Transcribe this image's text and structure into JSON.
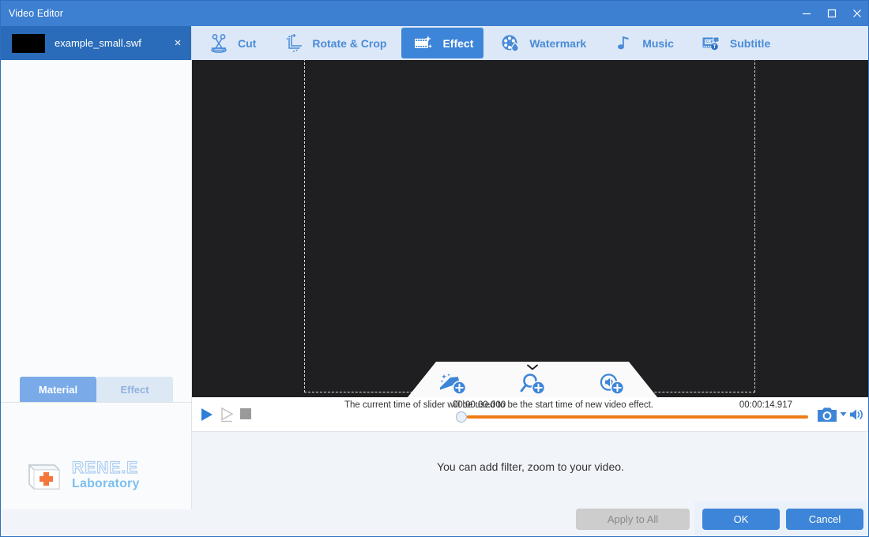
{
  "window": {
    "title": "Video Editor",
    "controls": [
      {
        "name": "minimize",
        "glyph": "minimize-icon"
      },
      {
        "name": "maximize",
        "glyph": "maximize-icon"
      },
      {
        "name": "close",
        "glyph": "close-icon"
      }
    ]
  },
  "sidebar": {
    "file": {
      "name": "example_small.swf",
      "close_label": "×",
      "thumbnail": "black-thumbnail"
    },
    "tabs": [
      {
        "label": "Material",
        "active": true
      },
      {
        "label": "Effect",
        "active": false
      }
    ],
    "logo": {
      "main": "RENE.E",
      "sub": "Laboratory",
      "icon": "rene-key-logo-icon"
    }
  },
  "toolbar": {
    "tabs": [
      {
        "label": "Cut",
        "icon": "scissors-icon",
        "active": false
      },
      {
        "label": "Rotate & Crop",
        "icon": "rotate-crop-icon",
        "active": false
      },
      {
        "label": "Effect",
        "icon": "film-sparkle-icon",
        "active": true
      },
      {
        "label": "Watermark",
        "icon": "watermark-droplet-icon",
        "active": false
      },
      {
        "label": "Music",
        "icon": "music-note-icon",
        "active": false
      },
      {
        "label": "Subtitle",
        "icon": "subtitle-icon",
        "active": false
      }
    ]
  },
  "preview": {
    "selection_visible": true,
    "effect_popup": {
      "chevron": "chevron-down-icon",
      "actions": [
        {
          "name": "add-filter",
          "icon": "magic-wand-plus-icon"
        },
        {
          "name": "add-zoom",
          "icon": "magnifier-plus-icon"
        },
        {
          "name": "add-volume",
          "icon": "speaker-plus-icon"
        }
      ]
    }
  },
  "transport": {
    "play": "play-icon",
    "step": "step-forward-icon",
    "stop": "stop-icon",
    "start_time": "00:00:00.000",
    "end_time": "00:00:14.917",
    "hint": "The current time of slider will be used to be the start time of new video effect.",
    "snapshot": "camera-icon",
    "snapshot_caret": "caret-down-icon",
    "volume": "speaker-icon",
    "progress_percent": 0
  },
  "description": {
    "text": "You can add filter, zoom to your video."
  },
  "footer": {
    "apply_to_all": "Apply to All",
    "ok": "OK",
    "cancel": "Cancel"
  },
  "colors": {
    "accent": "#3d85d8",
    "titlebar": "#3d7fd0",
    "toolbar": "#dce8f7",
    "track": "#f07c15",
    "preview_bg": "#1f1f21",
    "disabled": "#cdcdcd"
  }
}
